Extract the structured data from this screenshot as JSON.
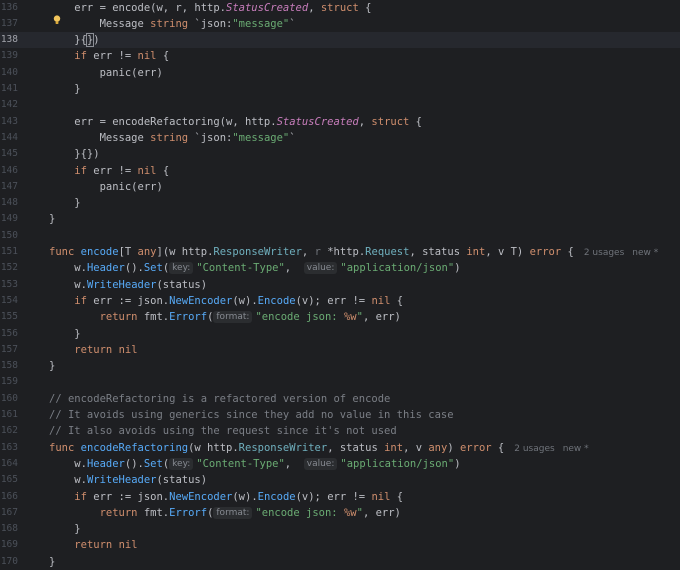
{
  "editor": {
    "lines": [
      {
        "n": "136",
        "tokens": [
          [
            "    err = encode(w, r, http.",
            ""
          ],
          [
            "StatusCreated",
            "ital"
          ],
          [
            ", ",
            ""
          ],
          [
            "struct",
            "kw"
          ],
          [
            " {",
            ""
          ]
        ]
      },
      {
        "n": "137",
        "tokens": [
          [
            "        Message ",
            ""
          ],
          [
            "string",
            "kw"
          ],
          [
            " `json:",
            ""
          ],
          [
            "\"message\"",
            "str"
          ],
          [
            "`",
            ""
          ]
        ]
      },
      {
        "n": "138",
        "current": true,
        "tokens": [
          [
            "    }{",
            ""
          ],
          [
            "}",
            "caret"
          ],
          [
            ")",
            ""
          ]
        ]
      },
      {
        "n": "139",
        "tokens": [
          [
            "    ",
            ""
          ],
          [
            "if",
            "kw"
          ],
          [
            " err != ",
            ""
          ],
          [
            "nil",
            "kw"
          ],
          [
            " {",
            ""
          ]
        ]
      },
      {
        "n": "140",
        "tokens": [
          [
            "        panic(err)",
            ""
          ]
        ]
      },
      {
        "n": "141",
        "tokens": [
          [
            "    }",
            ""
          ]
        ]
      },
      {
        "n": "142",
        "tokens": []
      },
      {
        "n": "143",
        "tokens": [
          [
            "    err = encodeRefactoring(w, http.",
            ""
          ],
          [
            "StatusCreated",
            "ital"
          ],
          [
            ", ",
            ""
          ],
          [
            "struct",
            "kw"
          ],
          [
            " {",
            ""
          ]
        ]
      },
      {
        "n": "144",
        "tokens": [
          [
            "        Message ",
            ""
          ],
          [
            "string",
            "kw"
          ],
          [
            " `json:",
            ""
          ],
          [
            "\"message\"",
            "str"
          ],
          [
            "`",
            ""
          ]
        ]
      },
      {
        "n": "145",
        "tokens": [
          [
            "    }{})",
            ""
          ]
        ]
      },
      {
        "n": "146",
        "tokens": [
          [
            "    ",
            ""
          ],
          [
            "if",
            "kw"
          ],
          [
            " err != ",
            ""
          ],
          [
            "nil",
            "kw"
          ],
          [
            " {",
            ""
          ]
        ]
      },
      {
        "n": "147",
        "tokens": [
          [
            "        panic(err)",
            ""
          ]
        ]
      },
      {
        "n": "148",
        "tokens": [
          [
            "    }",
            ""
          ]
        ]
      },
      {
        "n": "149",
        "tokens": [
          [
            "}",
            ""
          ]
        ]
      },
      {
        "n": "150",
        "tokens": []
      },
      {
        "n": "151",
        "tokens": [
          [
            "func",
            "kw"
          ],
          [
            " ",
            ""
          ],
          [
            "encode",
            "fn"
          ],
          [
            "[T ",
            ""
          ],
          [
            "any",
            "kw"
          ],
          [
            "](w http.",
            ""
          ],
          [
            "ResponseWriter",
            "typ"
          ],
          [
            ", ",
            ""
          ],
          [
            "r",
            "param"
          ],
          [
            " *http.",
            ""
          ],
          [
            "Request",
            "typ"
          ],
          [
            ", status ",
            ""
          ],
          [
            "int",
            "kw"
          ],
          [
            ", v T) ",
            ""
          ],
          [
            "error",
            "kw"
          ],
          [
            " {",
            ""
          ]
        ],
        "meta": [
          "2 usages",
          "new *"
        ]
      },
      {
        "n": "152",
        "tokens": [
          [
            "    w.",
            ""
          ],
          [
            "Header",
            "fn"
          ],
          [
            "().",
            ""
          ],
          [
            "Set",
            "fn"
          ],
          [
            "(",
            ""
          ],
          [
            "key:",
            "hint"
          ],
          [
            "\"Content-Type\"",
            "str"
          ],
          [
            ",  ",
            ""
          ],
          [
            "value:",
            "hint"
          ],
          [
            "\"application/json\"",
            "str"
          ],
          [
            ")",
            ""
          ]
        ]
      },
      {
        "n": "153",
        "tokens": [
          [
            "    w.",
            ""
          ],
          [
            "WriteHeader",
            "fn"
          ],
          [
            "(status)",
            ""
          ]
        ]
      },
      {
        "n": "154",
        "tokens": [
          [
            "    ",
            ""
          ],
          [
            "if",
            "kw"
          ],
          [
            " err := json.",
            ""
          ],
          [
            "NewEncoder",
            "fn"
          ],
          [
            "(w).",
            ""
          ],
          [
            "Encode",
            "fn"
          ],
          [
            "(v); err != ",
            ""
          ],
          [
            "nil",
            "kw"
          ],
          [
            " {",
            ""
          ]
        ]
      },
      {
        "n": "155",
        "tokens": [
          [
            "        ",
            ""
          ],
          [
            "return",
            "kw"
          ],
          [
            " fmt.",
            ""
          ],
          [
            "Errorf",
            "fn"
          ],
          [
            "(",
            ""
          ],
          [
            "format:",
            "hint"
          ],
          [
            "\"encode json: ",
            "str"
          ],
          [
            "%w",
            "kw"
          ],
          [
            "\"",
            "str"
          ],
          [
            ", err)",
            ""
          ]
        ]
      },
      {
        "n": "156",
        "tokens": [
          [
            "    }",
            ""
          ]
        ]
      },
      {
        "n": "157",
        "tokens": [
          [
            "    ",
            ""
          ],
          [
            "return",
            "kw"
          ],
          [
            " ",
            ""
          ],
          [
            "nil",
            "kw"
          ]
        ]
      },
      {
        "n": "158",
        "tokens": [
          [
            "}",
            ""
          ]
        ]
      },
      {
        "n": "159",
        "tokens": []
      },
      {
        "n": "160",
        "tokens": [
          [
            "// encodeRefactoring is a refactored version of encode",
            "cm"
          ]
        ]
      },
      {
        "n": "161",
        "tokens": [
          [
            "// It avoids using generics since they add no value in this case",
            "cm"
          ]
        ]
      },
      {
        "n": "162",
        "tokens": [
          [
            "// It also avoids using the request since it's not used",
            "cm"
          ]
        ]
      },
      {
        "n": "163",
        "tokens": [
          [
            "func",
            "kw"
          ],
          [
            " ",
            ""
          ],
          [
            "encodeRefactoring",
            "fn"
          ],
          [
            "(w http.",
            ""
          ],
          [
            "ResponseWriter",
            "typ"
          ],
          [
            ", status ",
            ""
          ],
          [
            "int",
            "kw"
          ],
          [
            ", v ",
            ""
          ],
          [
            "any",
            "kw"
          ],
          [
            ") ",
            ""
          ],
          [
            "error",
            "kw"
          ],
          [
            " {",
            ""
          ]
        ],
        "meta": [
          "2 usages",
          "new *"
        ]
      },
      {
        "n": "164",
        "tokens": [
          [
            "    w.",
            ""
          ],
          [
            "Header",
            "fn"
          ],
          [
            "().",
            ""
          ],
          [
            "Set",
            "fn"
          ],
          [
            "(",
            ""
          ],
          [
            "key:",
            "hint"
          ],
          [
            "\"Content-Type\"",
            "str"
          ],
          [
            ",  ",
            ""
          ],
          [
            "value:",
            "hint"
          ],
          [
            "\"application/json\"",
            "str"
          ],
          [
            ")",
            ""
          ]
        ]
      },
      {
        "n": "165",
        "tokens": [
          [
            "    w.",
            ""
          ],
          [
            "WriteHeader",
            "fn"
          ],
          [
            "(status)",
            ""
          ]
        ]
      },
      {
        "n": "166",
        "tokens": [
          [
            "    ",
            ""
          ],
          [
            "if",
            "kw"
          ],
          [
            " err := json.",
            ""
          ],
          [
            "NewEncoder",
            "fn"
          ],
          [
            "(w).",
            ""
          ],
          [
            "Encode",
            "fn"
          ],
          [
            "(v); err != ",
            ""
          ],
          [
            "nil",
            "kw"
          ],
          [
            " {",
            ""
          ]
        ]
      },
      {
        "n": "167",
        "tokens": [
          [
            "        ",
            ""
          ],
          [
            "return",
            "kw"
          ],
          [
            " fmt.",
            ""
          ],
          [
            "Errorf",
            "fn"
          ],
          [
            "(",
            ""
          ],
          [
            "format:",
            "hint"
          ],
          [
            "\"encode json: ",
            "str"
          ],
          [
            "%w",
            "kw"
          ],
          [
            "\"",
            "str"
          ],
          [
            ", err)",
            ""
          ]
        ]
      },
      {
        "n": "168",
        "tokens": [
          [
            "    }",
            ""
          ]
        ]
      },
      {
        "n": "169",
        "tokens": [
          [
            "    ",
            ""
          ],
          [
            "return",
            "kw"
          ],
          [
            " ",
            ""
          ],
          [
            "nil",
            "kw"
          ]
        ]
      },
      {
        "n": "170",
        "tokens": [
          [
            "}",
            ""
          ]
        ]
      }
    ]
  },
  "colors": {
    "background": "#1e1f22",
    "keyword": "#cf8e6d",
    "string": "#6aab73",
    "function": "#57aaf7",
    "comment": "#7a7e85",
    "current_line": "#26282e"
  },
  "icons": {
    "intention_bulb": "lightbulb-icon"
  }
}
